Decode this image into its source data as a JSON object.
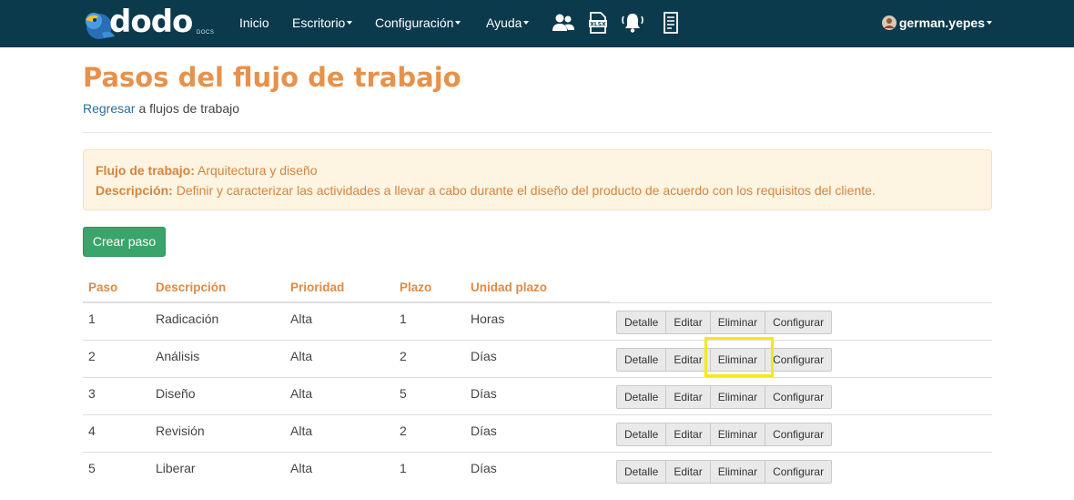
{
  "navbar": {
    "logo_text": "dodo",
    "logo_sub": "DOCS",
    "items": [
      {
        "label": "Inicio"
      },
      {
        "label": "Escritorio"
      },
      {
        "label": "Configuración"
      },
      {
        "label": "Ayuda"
      }
    ],
    "user": "german.yepes"
  },
  "page": {
    "title": "Pasos del flujo de trabajo",
    "back_link": "Regresar",
    "back_suffix": " a flujos de trabajo"
  },
  "info": {
    "workflow_label": "Flujo de trabajo:",
    "workflow_value": " Arquitectura y diseño",
    "description_label": "Descripción:",
    "description_value": " Definir y caracterizar las actividades a llevar a cabo durante el diseño del producto de acuerdo con los requisitos del cliente."
  },
  "create_button": "Crear paso",
  "table": {
    "headers": [
      "Paso",
      "Descripción",
      "Prioridad",
      "Plazo",
      "Unidad plazo"
    ],
    "actions": [
      "Detalle",
      "Editar",
      "Eliminar",
      "Configurar"
    ],
    "rows": [
      [
        "1",
        "Radicación",
        "Alta",
        "1",
        "Horas"
      ],
      [
        "2",
        "Análisis",
        "Alta",
        "2",
        "Días"
      ],
      [
        "3",
        "Diseño",
        "Alta",
        "5",
        "Días"
      ],
      [
        "4",
        "Revisión",
        "Alta",
        "2",
        "Días"
      ],
      [
        "5",
        "Liberar",
        "Alta",
        "1",
        "Días"
      ]
    ]
  },
  "colors": {
    "navbar": "#0b3a4c",
    "accent": "#e8914a",
    "success": "#3aa56a",
    "highlight": "#f5e81a"
  }
}
